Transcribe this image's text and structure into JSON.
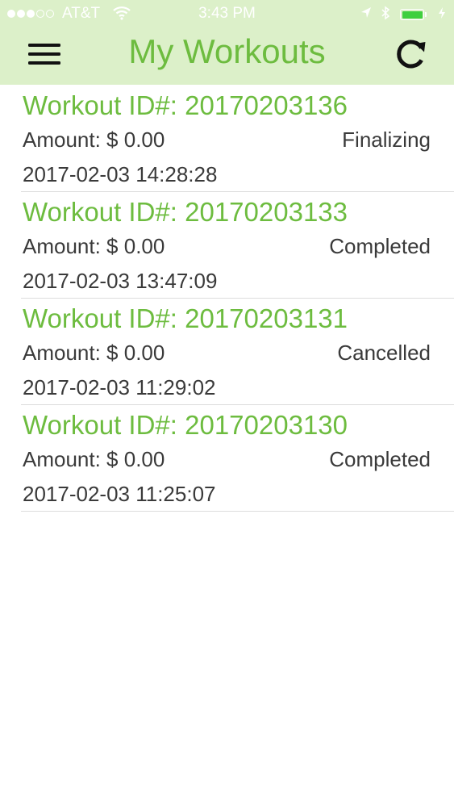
{
  "status_bar": {
    "carrier": "AT&T",
    "time": "3:43 PM",
    "battery_charging": true
  },
  "header": {
    "title": "My Workouts",
    "menu_icon": "hamburger-menu-icon",
    "refresh_icon": "refresh-icon",
    "accent_color": "#6dbc3f",
    "background_color": "#dcf0c9"
  },
  "workouts": [
    {
      "id_label": "Workout ID#: 20170203136",
      "amount": "Amount: $ 0.00",
      "status": "Finalizing",
      "date": "2017-02-03 14:28:28"
    },
    {
      "id_label": "Workout ID#: 20170203133",
      "amount": "Amount: $ 0.00",
      "status": "Completed",
      "date": "2017-02-03 13:47:09"
    },
    {
      "id_label": "Workout ID#: 20170203131",
      "amount": "Amount: $ 0.00",
      "status": "Cancelled",
      "date": "2017-02-03 11:29:02"
    },
    {
      "id_label": "Workout ID#: 20170203130",
      "amount": "Amount: $ 0.00",
      "status": "Completed",
      "date": "2017-02-03 11:25:07"
    }
  ]
}
